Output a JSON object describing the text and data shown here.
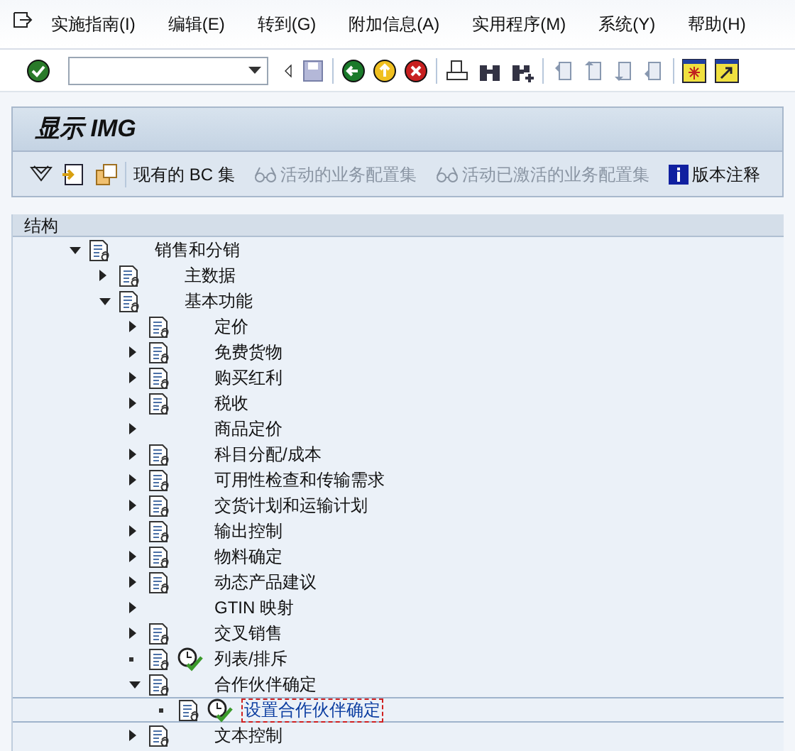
{
  "menu": [
    "实施指南(I)",
    "编辑(E)",
    "转到(G)",
    "附加信息(A)",
    "实用程序(M)",
    "系统(Y)",
    "帮助(H)"
  ],
  "screen_title": "显示 IMG",
  "app_toolbar": [
    {
      "kind": "text",
      "label": "现有的 BC 集",
      "disabled": false
    },
    {
      "kind": "glasses",
      "label": "活动的业务配置集",
      "disabled": true
    },
    {
      "kind": "glasses",
      "label": "活动已激活的业务配置集",
      "disabled": true
    },
    {
      "kind": "info",
      "label": "版本注释",
      "disabled": false
    }
  ],
  "tree": {
    "header": "结构",
    "nodes": [
      {
        "label": "销售和分销",
        "kind": "folder",
        "expanded": true,
        "doc": true,
        "activity": false,
        "selected": false,
        "children": [
          {
            "label": "主数据",
            "kind": "folder",
            "expanded": false,
            "doc": true,
            "activity": false,
            "selected": false
          },
          {
            "label": "基本功能",
            "kind": "folder",
            "expanded": true,
            "doc": true,
            "activity": false,
            "selected": false,
            "children": [
              {
                "label": "定价",
                "kind": "folder",
                "expanded": false,
                "doc": true,
                "activity": false,
                "selected": false
              },
              {
                "label": "免费货物",
                "kind": "folder",
                "expanded": false,
                "doc": true,
                "activity": false,
                "selected": false
              },
              {
                "label": "购买红利",
                "kind": "folder",
                "expanded": false,
                "doc": true,
                "activity": false,
                "selected": false
              },
              {
                "label": "税收",
                "kind": "folder",
                "expanded": false,
                "doc": true,
                "activity": false,
                "selected": false
              },
              {
                "label": "商品定价",
                "kind": "folder",
                "expanded": false,
                "doc": false,
                "activity": false,
                "selected": false
              },
              {
                "label": "科目分配/成本",
                "kind": "folder",
                "expanded": false,
                "doc": true,
                "activity": false,
                "selected": false
              },
              {
                "label": "可用性检查和传输需求",
                "kind": "folder",
                "expanded": false,
                "doc": true,
                "activity": false,
                "selected": false
              },
              {
                "label": "交货计划和运输计划",
                "kind": "folder",
                "expanded": false,
                "doc": true,
                "activity": false,
                "selected": false
              },
              {
                "label": "输出控制",
                "kind": "folder",
                "expanded": false,
                "doc": true,
                "activity": false,
                "selected": false
              },
              {
                "label": "物料确定",
                "kind": "folder",
                "expanded": false,
                "doc": true,
                "activity": false,
                "selected": false
              },
              {
                "label": "动态产品建议",
                "kind": "folder",
                "expanded": false,
                "doc": true,
                "activity": false,
                "selected": false
              },
              {
                "label": "GTIN 映射",
                "kind": "folder",
                "expanded": false,
                "doc": false,
                "activity": false,
                "selected": false
              },
              {
                "label": "交叉销售",
                "kind": "folder",
                "expanded": false,
                "doc": true,
                "activity": false,
                "selected": false
              },
              {
                "label": "列表/排斥",
                "kind": "leaf",
                "doc": true,
                "activity": true,
                "selected": false
              },
              {
                "label": "合作伙伴确定",
                "kind": "folder",
                "expanded": true,
                "doc": true,
                "activity": false,
                "selected": false,
                "children": [
                  {
                    "label": "设置合作伙伴确定",
                    "kind": "leaf",
                    "doc": true,
                    "activity": true,
                    "selected": true
                  }
                ]
              },
              {
                "label": "文本控制",
                "kind": "folder",
                "expanded": false,
                "doc": true,
                "activity": false,
                "selected": false
              }
            ]
          }
        ]
      }
    ]
  }
}
